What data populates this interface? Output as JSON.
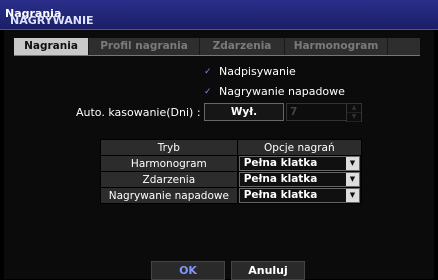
{
  "title": {
    "prefix": "NAGRYWANIE :",
    "name": "Nagrania"
  },
  "tabs": [
    {
      "label": "Nagrania",
      "active": true
    },
    {
      "label": "Profil nagrania",
      "active": false
    },
    {
      "label": "Zdarzenia",
      "active": false
    },
    {
      "label": "Harmonogram",
      "active": false
    }
  ],
  "options": {
    "overwrite": {
      "label": "Nadpisywanie",
      "checked": true
    },
    "panic": {
      "label": "Nagrywanie napadowe",
      "checked": true
    }
  },
  "auto_delete": {
    "label": "Auto. kasowanie(Dni) :",
    "value": "Wył.",
    "days": "7"
  },
  "table": {
    "headers": [
      "Tryb",
      "Opcje nagrań"
    ],
    "rows": [
      {
        "mode": "Harmonogram",
        "option": "Pełna klatka"
      },
      {
        "mode": "Zdarzenia",
        "option": "Pełna klatka"
      },
      {
        "mode": "Nagrywanie napadowe",
        "option": "Pełna klatka"
      }
    ]
  },
  "buttons": {
    "ok": "OK",
    "cancel": "Anuluj"
  },
  "colors": {
    "title_bar": "#1b1f66",
    "accent": "#7f95ff"
  }
}
